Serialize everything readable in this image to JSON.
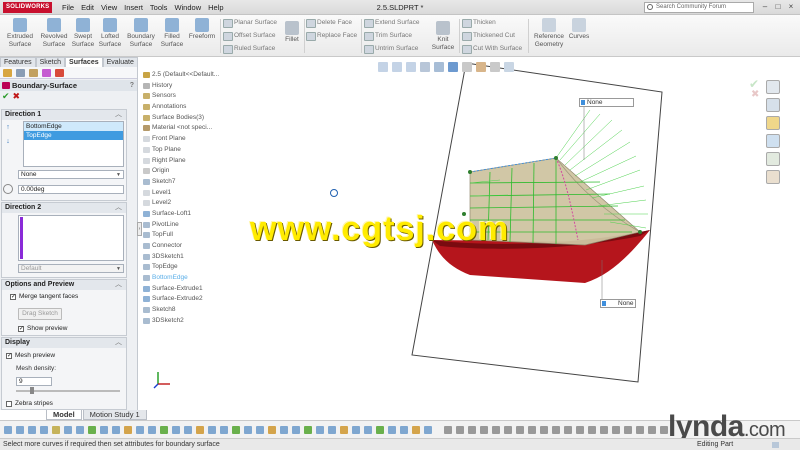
{
  "app": {
    "logo": "SOLIDWORKS",
    "menu": [
      "File",
      "Edit",
      "View",
      "Insert",
      "Tools",
      "Window",
      "Help"
    ],
    "document_title": "2.5.SLDPRT *",
    "search_placeholder": "Search Community Forum"
  },
  "ribbon": {
    "big_buttons": [
      {
        "label": "Extruded\nSurface",
        "color": "#7fa7d0"
      },
      {
        "label": "Revolved\nSurface",
        "color": "#7fa7d0"
      },
      {
        "label": "Swept\nSurface",
        "color": "#7fa7d0"
      },
      {
        "label": "Lofted\nSurface",
        "color": "#7fa7d0"
      },
      {
        "label": "Boundary\nSurface",
        "color": "#7fa7d0"
      },
      {
        "label": "Filled\nSurface",
        "color": "#7fa7d0"
      },
      {
        "label": "Freeform",
        "color": "#7fa7d0"
      }
    ],
    "group1": [
      "Planar Surface",
      "Offset Surface",
      "Ruled Surface"
    ],
    "fillet": "Fillet",
    "group2": [
      "Delete Face",
      "Replace Face"
    ],
    "group3": [
      "Extend Surface",
      "Trim Surface",
      "Untrim Surface"
    ],
    "knit": "Knit\nSurface",
    "group4": [
      "Thicken",
      "Thickened Cut",
      "Cut With Surface"
    ],
    "reference_geometry": "Reference\nGeometry",
    "curves": "Curves"
  },
  "panel": {
    "tabs": [
      "Features",
      "Sketch",
      "Surfaces",
      "Evaluate"
    ],
    "active_tab": "Surfaces",
    "title": "Boundary-Surface",
    "help": "?",
    "direction1": {
      "header": "Direction 1",
      "items": [
        "BottomEdge",
        "TopEdge"
      ],
      "tangency": "None",
      "angle": "0.00deg"
    },
    "direction2": {
      "header": "Direction 2",
      "tangency": "Default"
    },
    "options": {
      "header": "Options and Preview",
      "merge_tangent": "Merge tangent faces",
      "drag_sketch": "Drag Sketch",
      "show_preview": "Show preview"
    },
    "display": {
      "header": "Display",
      "mesh_preview": "Mesh preview",
      "mesh_density_label": "Mesh density:",
      "mesh_density": "9",
      "zebra": "Zebra stripes"
    }
  },
  "tree": [
    {
      "label": "2.5  (Default<<Default..."
    },
    {
      "label": "History"
    },
    {
      "label": "Sensors"
    },
    {
      "label": "Annotations"
    },
    {
      "label": "Surface Bodies(3)"
    },
    {
      "label": "Material <not speci..."
    },
    {
      "label": "Front Plane"
    },
    {
      "label": "Top Plane"
    },
    {
      "label": "Right Plane"
    },
    {
      "label": "Origin"
    },
    {
      "label": "Sketch7"
    },
    {
      "label": "Level1"
    },
    {
      "label": "Level2"
    },
    {
      "label": "Surface-Loft1"
    },
    {
      "label": "PivotLine"
    },
    {
      "label": "TopFull"
    },
    {
      "label": "Connector"
    },
    {
      "label": "3DSketch1"
    },
    {
      "label": "TopEdge"
    },
    {
      "label": "BottomEdge"
    },
    {
      "label": "Surface-Extrude1"
    },
    {
      "label": "Surface-Extrude2"
    },
    {
      "label": "Sketch8"
    },
    {
      "label": "3DSketch2"
    }
  ],
  "viewport": {
    "callout1": "None",
    "callout2": "None"
  },
  "bottom": {
    "tabs": [
      "Model",
      "Motion Study 1"
    ],
    "active_tab": "Model",
    "status": "Select more curves if required then set attributes for boundary surface",
    "mode": "Editing Part"
  },
  "watermarks": {
    "site": "www.cgtsj.com",
    "brand": "lynda",
    "brand_suffix": ".com"
  }
}
